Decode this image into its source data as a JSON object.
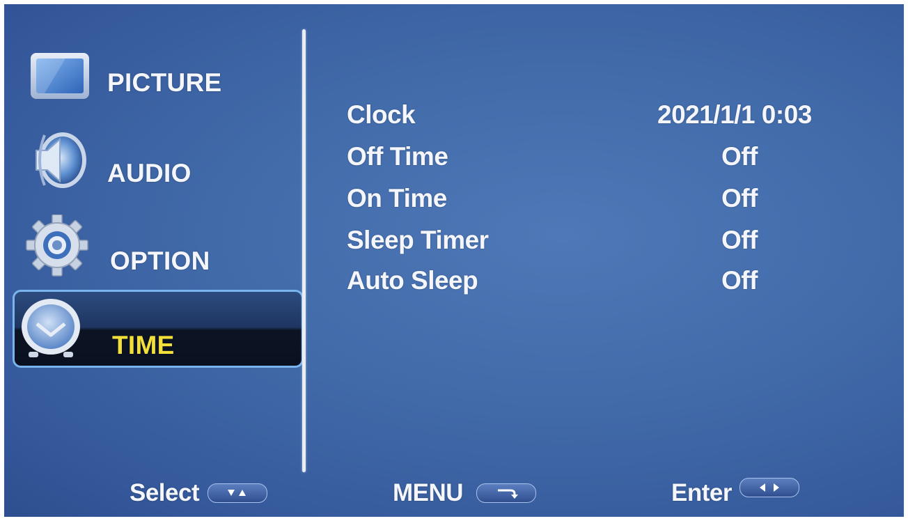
{
  "sidebar": {
    "items": [
      {
        "label": "PICTURE",
        "icon": "monitor-icon",
        "active": false
      },
      {
        "label": "AUDIO",
        "icon": "speaker-icon",
        "active": false
      },
      {
        "label": "OPTION",
        "icon": "gear-icon",
        "active": false
      },
      {
        "label": "TIME",
        "icon": "clock-icon",
        "active": true
      }
    ]
  },
  "settings": {
    "rows": [
      {
        "label": "Clock",
        "value": "2021/1/1 0:03"
      },
      {
        "label": "Off Time",
        "value": "Off"
      },
      {
        "label": "On Time",
        "value": "Off"
      },
      {
        "label": "Sleep Timer",
        "value": "Off"
      },
      {
        "label": "Auto Sleep",
        "value": "Off"
      }
    ]
  },
  "footer": {
    "select_label": "Select",
    "menu_label": "MENU",
    "enter_label": "Enter"
  },
  "colors": {
    "background": "#416aa9",
    "active_label": "#f2df39",
    "text": "#f4f6fb",
    "highlight_border": "#7ab4ec"
  }
}
